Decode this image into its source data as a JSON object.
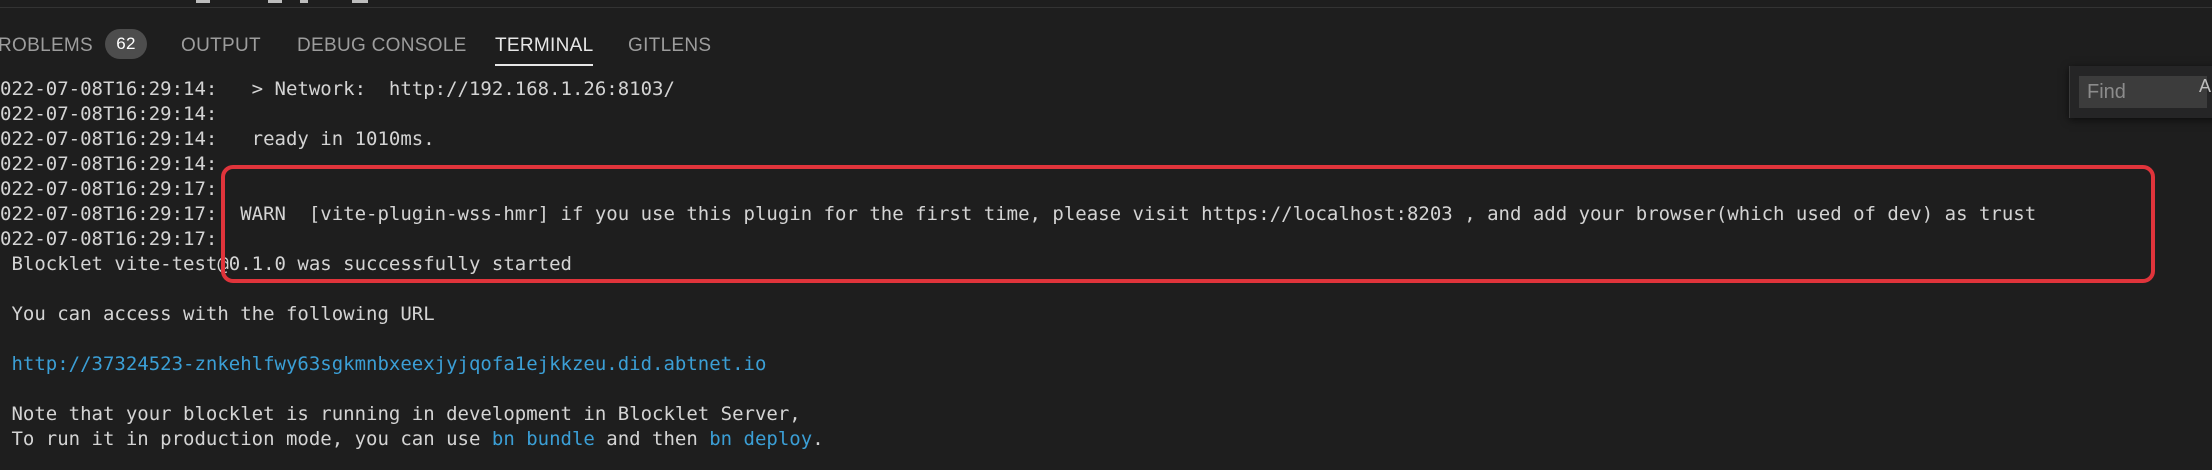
{
  "tabs": [
    {
      "label": "ROBLEMS",
      "badge": "62"
    },
    {
      "label": "OUTPUT"
    },
    {
      "label": "DEBUG CONSOLE"
    },
    {
      "label": "TERMINAL"
    },
    {
      "label": "GITLENS"
    }
  ],
  "active_tab": "TERMINAL",
  "find": {
    "placeholder": "Find",
    "option_label": "A"
  },
  "terminal": {
    "lines": [
      "022-07-08T16:29:14:   > Network:  http://192.168.1.26:8103/",
      "022-07-08T16:29:14:",
      "022-07-08T16:29:14:   ready in 1010ms.",
      "022-07-08T16:29:14:",
      "022-07-08T16:29:17:",
      "022-07-08T16:29:17:  WARN  [vite-plugin-wss-hmr] if you use this plugin for the first time, please visit https://localhost:8203 , and add your browser(which used of dev) as trust",
      "022-07-08T16:29:17:",
      " Blocklet vite-test@0.1.0 was successfully started",
      "",
      " You can access with the following URL",
      "",
      "http://37324523-znkehlfwy63sgkmnbxeexjyjqofa1ejkkzeu.did.abtnet.io",
      "",
      " Note that your blocklet is running in development in Blocklet Server,"
    ],
    "url_line": " http://37324523-znkehlfwy63sgkmnbxeexjyjqofa1ejkkzeu.did.abtnet.io",
    "last_line": {
      "prefix": " To run it in production mode, you can use ",
      "cmd1": "bn bundle",
      "middle": " and then ",
      "cmd2": "bn deploy",
      "suffix": "."
    }
  },
  "colors": {
    "background": "#1e1e1e",
    "link": "#3b9fd6",
    "highlight_box": "#e0343b"
  }
}
